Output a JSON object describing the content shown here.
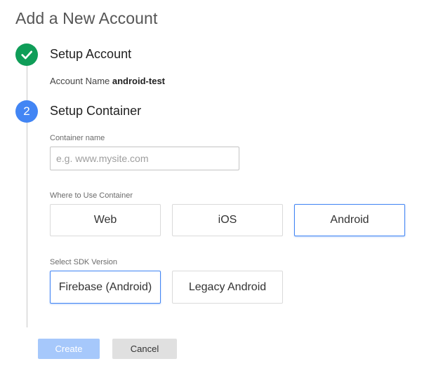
{
  "page": {
    "title": "Add a New Account"
  },
  "steps": [
    {
      "title": "Setup Account",
      "status": "done"
    },
    {
      "title": "Setup Container",
      "number": "2",
      "status": "active"
    }
  ],
  "account": {
    "name_label": "Account Name",
    "name_value": "android-test"
  },
  "container": {
    "name_label": "Container name",
    "name_placeholder": "e.g. www.mysite.com",
    "name_value": "",
    "where_label": "Where to Use Container",
    "where_options": [
      "Web",
      "iOS",
      "Android"
    ],
    "where_selected": "Android",
    "sdk_label": "Select SDK Version",
    "sdk_options": [
      "Firebase (Android)",
      "Legacy Android"
    ],
    "sdk_selected": "Firebase (Android)"
  },
  "actions": {
    "create_label": "Create",
    "cancel_label": "Cancel"
  },
  "colors": {
    "done": "#0f9d58",
    "active": "#4285f4",
    "create_disabled": "#a6c8fb"
  },
  "icons": {
    "step_done": "check-icon"
  }
}
